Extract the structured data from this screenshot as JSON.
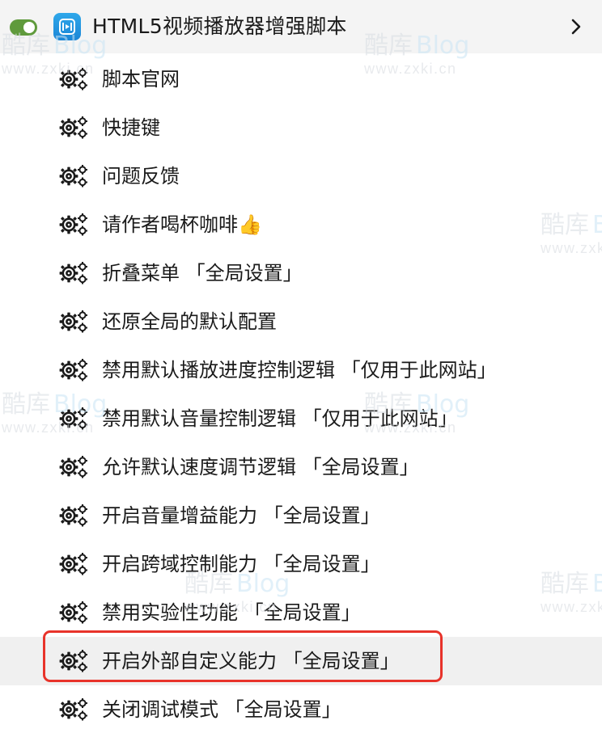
{
  "header": {
    "title": "HTML5视频播放器增强脚本",
    "toggle_state": "on",
    "app_icon": "video-player-icon",
    "expand_icon": "chevron-right-icon"
  },
  "menu": {
    "item_icon": "gear-icon",
    "items": [
      {
        "label": "脚本官网"
      },
      {
        "label": "快捷键"
      },
      {
        "label": "问题反馈"
      },
      {
        "label": "请作者喝杯咖啡👍"
      },
      {
        "label": "折叠菜单 「全局设置」"
      },
      {
        "label": "还原全局的默认配置"
      },
      {
        "label": "禁用默认播放进度控制逻辑 「仅用于此网站」"
      },
      {
        "label": "禁用默认音量控制逻辑 「仅用于此网站」"
      },
      {
        "label": "允许默认速度调节逻辑 「全局设置」"
      },
      {
        "label": "开启音量增益能力 「全局设置」"
      },
      {
        "label": "开启跨域控制能力 「全局设置」"
      },
      {
        "label": "禁用实验性功能 「全局设置」"
      },
      {
        "label": "开启外部自定义能力 「全局设置」"
      },
      {
        "label": "关闭调试模式 「全局设置」"
      }
    ]
  },
  "watermark": {
    "brand": "酷库",
    "brand_suffix": "Blog",
    "url": "www.zxki.cn"
  },
  "colors": {
    "toggle_on": "#5f9a3c",
    "app_icon": "#1b86d6",
    "highlight_border": "#e8332a",
    "header_background": "#f4f4f4"
  }
}
